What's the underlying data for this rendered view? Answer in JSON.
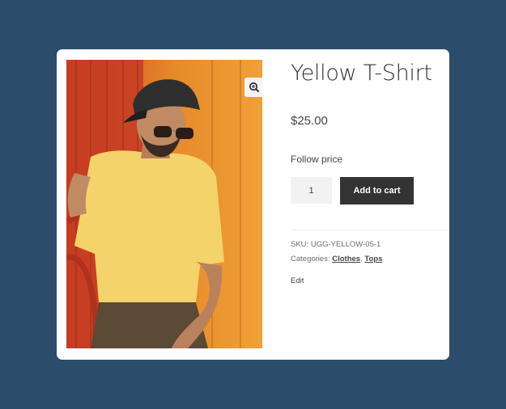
{
  "product": {
    "title": "Yellow T-Shirt",
    "price": "$25.00",
    "follow_price_label": "Follow price",
    "quantity": "1",
    "add_to_cart_label": "Add to cart",
    "sku_label": "SKU:",
    "sku_value": "UGG-YELLOW-05-1",
    "categories_label": "Categories:",
    "categories": [
      "Clothes",
      "Tops"
    ],
    "category_separator": ",",
    "edit_label": "Edit"
  },
  "icons": {
    "zoom": "magnifier-zoom-icon"
  },
  "colors": {
    "page_background": "#2b4c6b",
    "card_background": "#ffffff",
    "button_background": "#333333",
    "button_text": "#ffffff",
    "quantity_background": "#f2f2f2"
  }
}
